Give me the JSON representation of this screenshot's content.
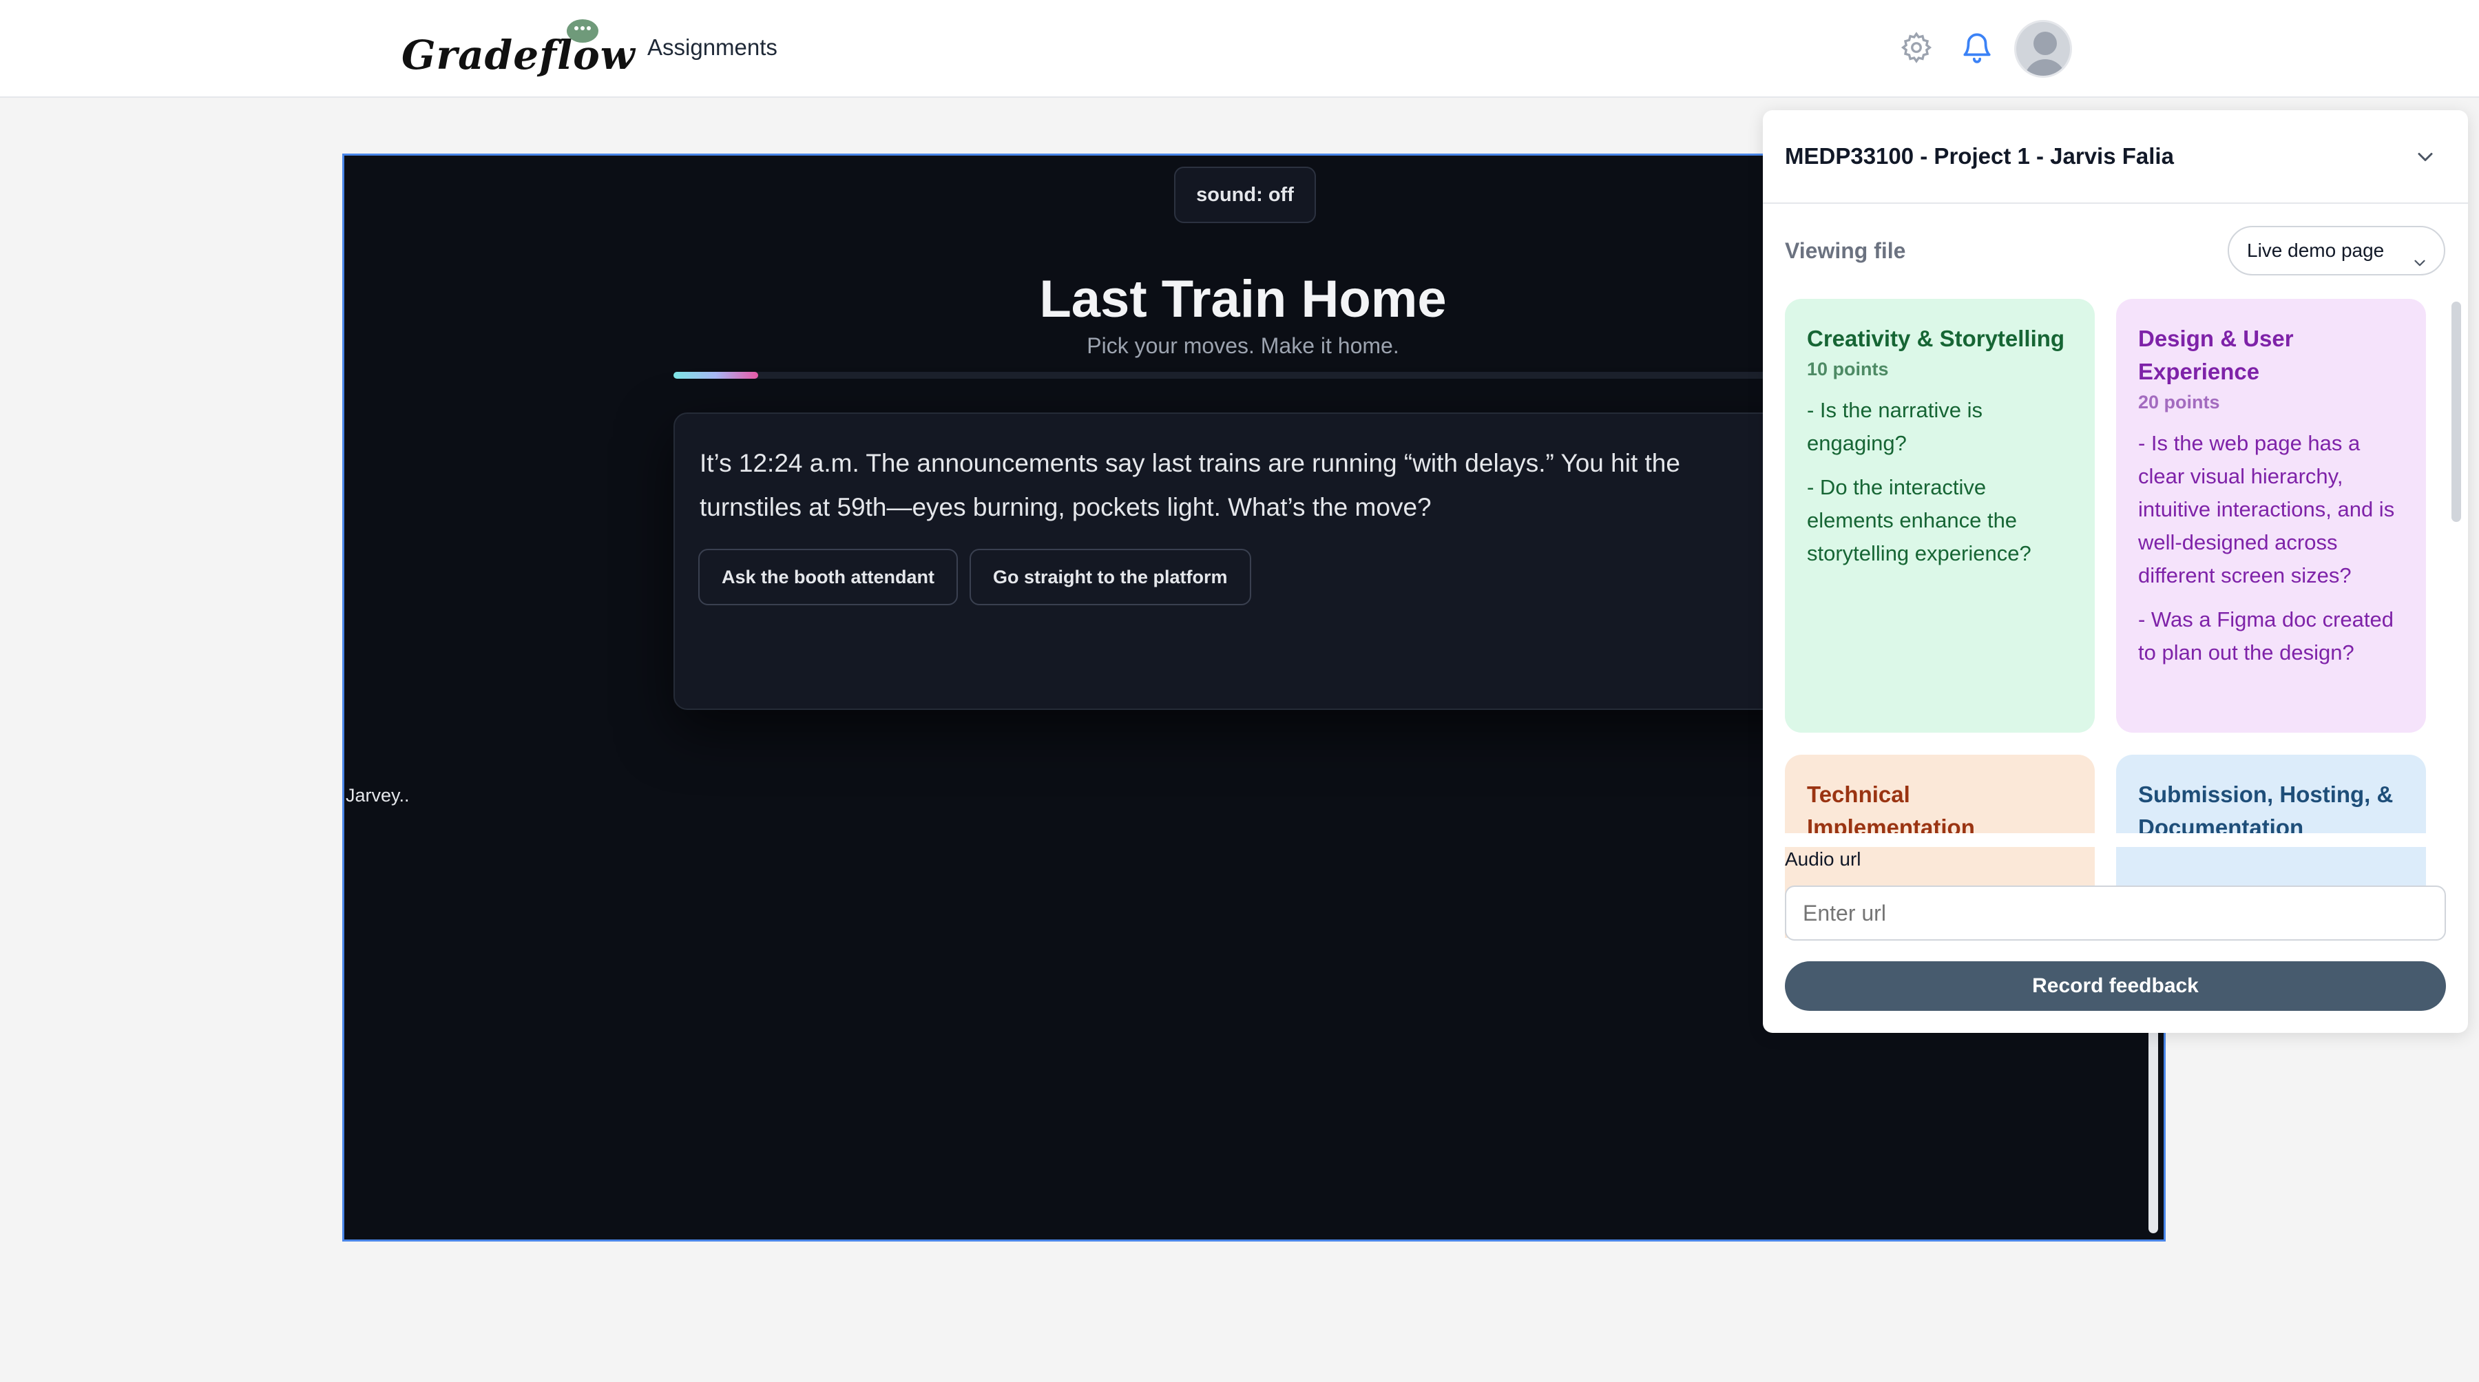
{
  "app": {
    "logo_text": "Gradeflow",
    "nav_assignments": "Assignments",
    "icons": [
      "gear-icon",
      "bell-icon",
      "avatar"
    ]
  },
  "preview": {
    "sound_label": "sound: off",
    "title": "Last Train Home",
    "subtitle": "Pick your moves. Make it home.",
    "progress": 0.07,
    "story_text": "It’s 12:24 a.m. The announcements say last trains are running “with delays.” You hit the turnstiles at 59th—eyes burning, pockets light. What’s the move?",
    "choices": [
      {
        "label": "Ask the booth attendant"
      },
      {
        "label": "Go straight to the platform"
      }
    ],
    "corner_label": "Jarvey.."
  },
  "panel": {
    "title": "MEDP33100 - Project 1 - Jarvis Falia",
    "viewing_label": "Viewing file",
    "file_selected": "Live demo page",
    "rubric": [
      {
        "title": "Creativity & Storytelling",
        "points": "10 points",
        "items": [
          "- Is the narrative is engaging?",
          "- Do the interactive elements enhance the storytelling experience?"
        ],
        "bg": "#dcf8e8",
        "title_color": "#166534",
        "points_color": "#4d8a64",
        "text_color": "#166534"
      },
      {
        "title": "Design & User Experience",
        "points": "20 points",
        "items": [
          "- Is the web page has a clear visual hierarchy, intuitive interactions, and is well-designed across different screen sizes?",
          "- Was a Figma doc created to plan out the design?"
        ],
        "bg": "#f5e3fb",
        "title_color": "#7e22a8",
        "points_color": "#a36bbf",
        "text_color": "#7e22a8"
      },
      {
        "title": "Technical Implementation",
        "points": "",
        "items": [],
        "bg": "#fbe8d8",
        "title_color": "#9a3412",
        "points_color": "#b45f3a",
        "text_color": "#9a3412"
      },
      {
        "title": "Submission, Hosting, & Documentation",
        "points": "",
        "items": [],
        "bg": "#dcecfa",
        "title_color": "#1e4e79",
        "points_color": "#4f7ba3",
        "text_color": "#1e4e79"
      }
    ],
    "audio_label": "Audio url",
    "audio_placeholder": "Enter url",
    "record_label": "Record feedback"
  }
}
